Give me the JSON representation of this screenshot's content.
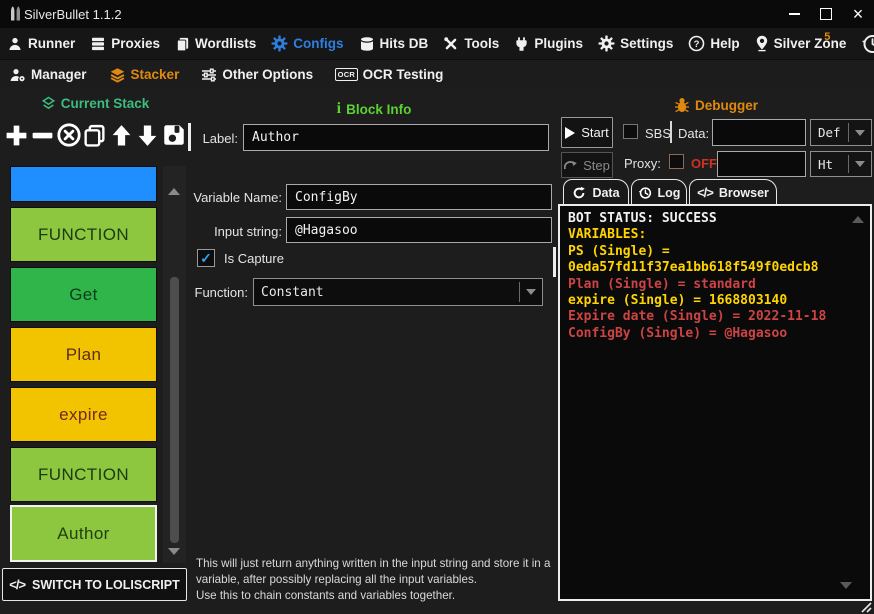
{
  "window": {
    "title": "SilverBullet 1.1.2"
  },
  "colors": {
    "accent_blue": "#2e7fe0",
    "accent_orange": "#e0890f",
    "stack_green": "#3dbd7d",
    "info_green": "#5ad232",
    "off_red": "#cc3322",
    "check_blue": "#2ea0f0"
  },
  "menu": {
    "items": [
      {
        "label": "Runner",
        "icon": "runner-icon"
      },
      {
        "label": "Proxies",
        "icon": "proxies-icon"
      },
      {
        "label": "Wordlists",
        "icon": "wordlists-icon"
      },
      {
        "label": "Configs",
        "icon": "configs-icon",
        "active": true
      },
      {
        "label": "Hits DB",
        "icon": "database-icon"
      },
      {
        "label": "Tools",
        "icon": "tools-icon"
      },
      {
        "label": "Plugins",
        "icon": "plugins-icon"
      },
      {
        "label": "Settings",
        "icon": "settings-icon"
      },
      {
        "label": "Help",
        "icon": "help-icon"
      },
      {
        "label": "Silver Zone",
        "icon": "map-pin-icon",
        "badge": "5"
      }
    ]
  },
  "subnav": {
    "items": [
      {
        "label": "Manager",
        "icon": "manager-icon"
      },
      {
        "label": "Stacker",
        "icon": "stacker-icon",
        "active": true
      },
      {
        "label": "Other Options",
        "icon": "sliders-icon"
      },
      {
        "label": "OCR Testing",
        "icon": "ocr-icon",
        "icon_text": "OCR"
      }
    ]
  },
  "stack": {
    "header": "Current Stack",
    "blocks": [
      {
        "label": "",
        "bg": "#1f8fff",
        "fg": "#0a2a4a"
      },
      {
        "label": "FUNCTION",
        "bg": "#8dc63f",
        "fg": "#1d3b12"
      },
      {
        "label": "Get",
        "bg": "#2fb549",
        "fg": "#0d3d1e"
      },
      {
        "label": "Plan",
        "bg": "#f2c400",
        "fg": "#5e2a1e"
      },
      {
        "label": "expire",
        "bg": "#f2c400",
        "fg": "#6e2a1e"
      },
      {
        "label": "FUNCTION",
        "bg": "#8dc63f",
        "fg": "#1d3b12"
      },
      {
        "label": "Author",
        "bg": "#8dc63f",
        "fg": "#20400e",
        "selected": true
      }
    ],
    "switch_button": "SWITCH TO LOLISCRIPT"
  },
  "block_info": {
    "header": "Block Info",
    "label_caption": "Label:",
    "label_value": "Author",
    "variable_caption": "Variable Name:",
    "variable_value": "ConfigBy",
    "input_caption": "Input string:",
    "input_value": "@Hagasoo",
    "capture_label": "Is Capture",
    "capture_checked": true,
    "function_caption": "Function:",
    "function_value": "Constant",
    "description": "This will just return anything written in the input string and store it in a variable, after possibly replacing all the input variables.\nUse this to chain constants and variables together."
  },
  "debugger": {
    "header": "Debugger",
    "start": "Start",
    "sbs": "SBS",
    "sbs_checked": false,
    "data_caption": "Data:",
    "data_value": "",
    "data_type": "Def",
    "step": "Step",
    "proxy_caption": "Proxy:",
    "proxy_checked": false,
    "proxy_state": "OFF",
    "proxy_value": "",
    "proxy_type": "Ht",
    "tabs": [
      {
        "label": "Data",
        "icon": "refresh-icon",
        "active": true
      },
      {
        "label": "Log",
        "icon": "history-icon"
      },
      {
        "label": "Browser",
        "icon": "code-icon"
      }
    ],
    "output": [
      {
        "text": "BOT STATUS: SUCCESS",
        "color": "#f2f2f2"
      },
      {
        "text": "VARIABLES:",
        "color": "#ffd400"
      },
      {
        "text": "PS (Single) =",
        "color": "#ffd400"
      },
      {
        "text": "0eda57fd11f37ea1bb618f549f0edcb8",
        "color": "#ffd400"
      },
      {
        "text": "Plan (Single) = standard",
        "color": "#c44"
      },
      {
        "text": "expire (Single) = 1668803140",
        "color": "#ffd400"
      },
      {
        "text": "Expire date (Single) = 2022-11-18",
        "color": "#c44"
      },
      {
        "text": "ConfigBy (Single) = @Hagasoo",
        "color": "#c44"
      }
    ]
  }
}
